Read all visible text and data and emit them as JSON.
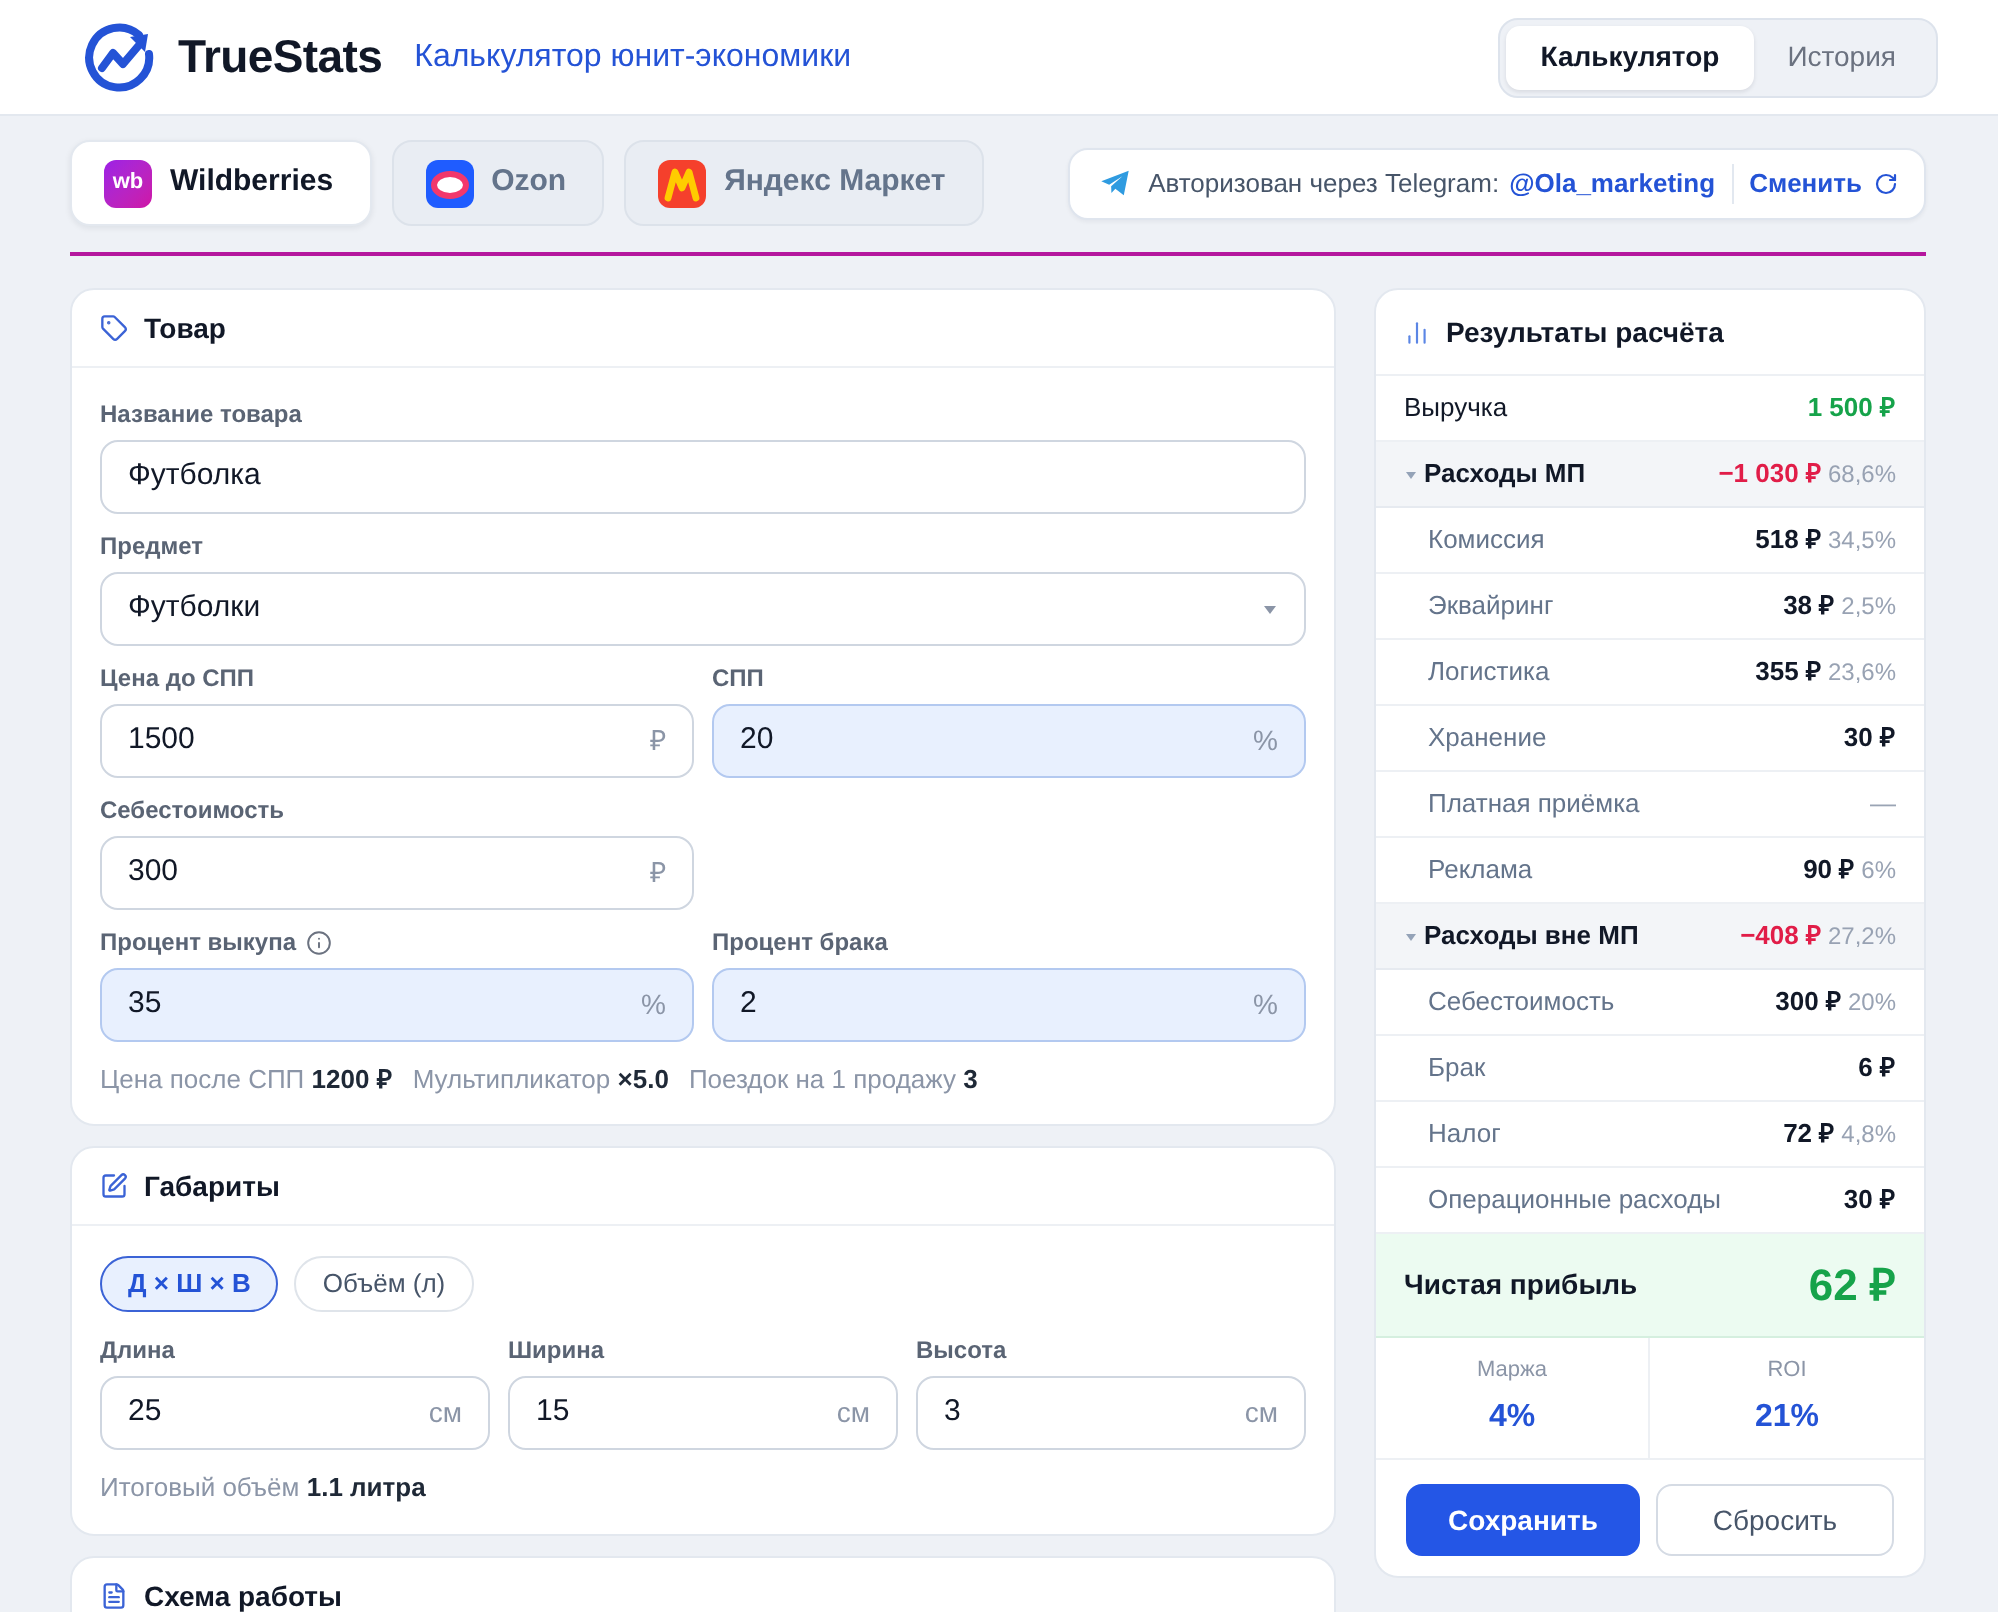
{
  "header": {
    "brand": "TrueStats",
    "subtitle": "Калькулятор юнит-экономики",
    "nav": [
      {
        "label": "Калькулятор",
        "selected": true
      },
      {
        "label": "История",
        "selected": false
      }
    ]
  },
  "marketplaces": [
    {
      "kind": "wb",
      "logo_text": "wb",
      "name": "Wildberries",
      "selected": true
    },
    {
      "kind": "ozon",
      "name": "Ozon",
      "selected": false
    },
    {
      "kind": "yandex",
      "name": "Яндекс Маркет",
      "selected": false
    }
  ],
  "auth": {
    "text": "Авторизован через Telegram:",
    "user": "@Ola_marketing",
    "action": "Сменить"
  },
  "product": {
    "title": "Товар",
    "rows": [
      [
        {
          "label": "Название товара",
          "kind": "text",
          "value": "Футболка",
          "info": false,
          "highlighted": false
        }
      ],
      [
        {
          "label": "Предмет",
          "kind": "select",
          "value": "Футболки",
          "info": false,
          "highlighted": false
        }
      ],
      [
        {
          "label": "Цена до СПП",
          "kind": "number",
          "value": "1500",
          "unit": "₽",
          "info": false,
          "highlighted": false
        },
        {
          "label": "СПП",
          "kind": "number",
          "value": "20",
          "unit": "%",
          "info": false,
          "highlighted": true
        }
      ],
      [
        {
          "label": "Себестоимость",
          "kind": "number",
          "value": "300",
          "unit": "₽",
          "info": false,
          "highlighted": false
        }
      ],
      [
        {
          "label": "Процент выкупа",
          "kind": "number",
          "value": "35",
          "unit": "%",
          "info": true,
          "highlighted": true
        },
        {
          "label": "Процент брака",
          "kind": "number",
          "value": "2",
          "unit": "%",
          "info": false,
          "highlighted": true
        }
      ]
    ],
    "summary": [
      {
        "label": "Цена после СПП",
        "value": "1200 ₽"
      },
      {
        "label": "Мультипликатор",
        "value": "×5.0"
      },
      {
        "label": "Поездок на 1 продажу",
        "value": "3"
      }
    ]
  },
  "dimensions": {
    "title": "Габариты",
    "modes": [
      {
        "label": "Д × Ш × В",
        "selected": true
      },
      {
        "label": "Объём (л)",
        "selected": false
      }
    ],
    "fields": [
      {
        "label": "Длина",
        "value": "25",
        "unit": "см"
      },
      {
        "label": "Ширина",
        "value": "15",
        "unit": "см"
      },
      {
        "label": "Высота",
        "value": "3",
        "unit": "см"
      }
    ],
    "total": {
      "label": "Итоговый объём",
      "value": "1.1 литра"
    }
  },
  "scheme": {
    "title": "Схема работы"
  },
  "results": {
    "title": "Результаты расчёта",
    "rows": [
      {
        "kind": "income",
        "label": "Выручка",
        "value": "1 500 ₽"
      },
      {
        "kind": "group",
        "label": "Расходы МП",
        "value": "−1 030 ₽",
        "share": "68,6%",
        "expanded": true,
        "children": [
          {
            "label": "Комиссия",
            "value": "518 ₽",
            "share": "34,5%",
            "muted": false
          },
          {
            "label": "Эквайринг",
            "value": "38 ₽",
            "share": "2,5%",
            "muted": false
          },
          {
            "label": "Логистика",
            "value": "355 ₽",
            "share": "23,6%",
            "muted": false
          },
          {
            "label": "Хранение",
            "value": "30 ₽",
            "muted": false
          },
          {
            "label": "Платная приёмка",
            "value": "—",
            "muted": true
          },
          {
            "label": "Реклама",
            "value": "90 ₽",
            "share": "6%",
            "muted": false
          }
        ]
      },
      {
        "kind": "group",
        "label": "Расходы вне МП",
        "value": "−408 ₽",
        "share": "27,2%",
        "expanded": true,
        "children": [
          {
            "label": "Себестоимость",
            "value": "300 ₽",
            "share": "20%",
            "muted": false
          },
          {
            "label": "Брак",
            "value": "6 ₽",
            "muted": false
          },
          {
            "label": "Налог",
            "value": "72 ₽",
            "share": "4,8%",
            "muted": false
          },
          {
            "label": "Операционные расходы",
            "value": "30 ₽",
            "muted": false
          }
        ]
      }
    ],
    "profit": {
      "label": "Чистая прибыль",
      "value": "62 ₽"
    },
    "metrics": [
      {
        "label": "Маржа",
        "value": "4%"
      },
      {
        "label": "ROI",
        "value": "21%"
      }
    ],
    "buttons": [
      {
        "kind": "primary",
        "label": "Сохранить"
      },
      {
        "kind": "secondary",
        "label": "Сбросить"
      }
    ]
  }
}
